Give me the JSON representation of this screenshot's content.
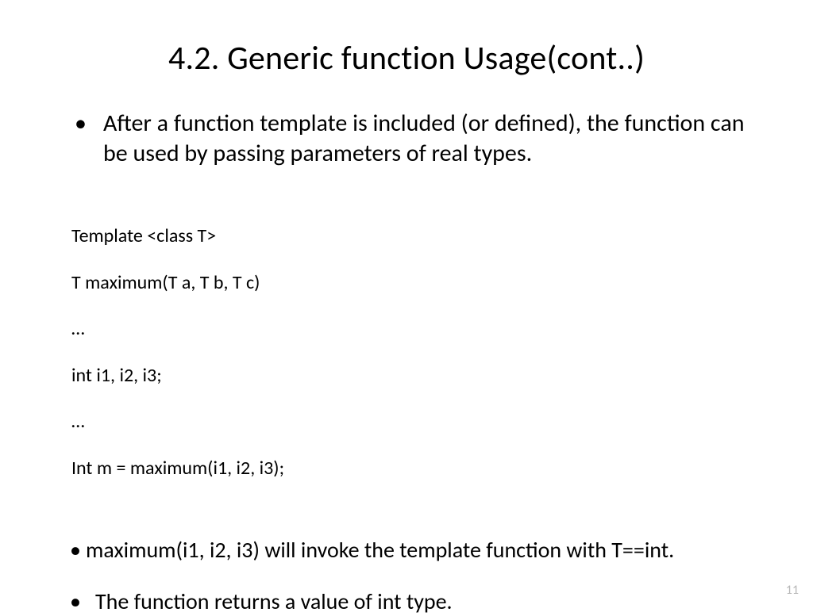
{
  "title": "4.2. Generic function Usage(cont..)",
  "bullets_top": [
    "After a function template is included (or defined), the function can be used by passing parameters of real types."
  ],
  "code": {
    "l1": "Template <class T>",
    "l2": "T maximum(T a, T b, T c)",
    "l3": "…",
    "l4": "int i1, i2, i3;",
    "l5": "…",
    "l6": "Int m = maximum(i1, i2, i3);"
  },
  "bullets_bottom": [
    "maximum(i1, i2, i3) will invoke the template function with T==int.",
    "The function returns a value of int type."
  ],
  "page_number": "11"
}
